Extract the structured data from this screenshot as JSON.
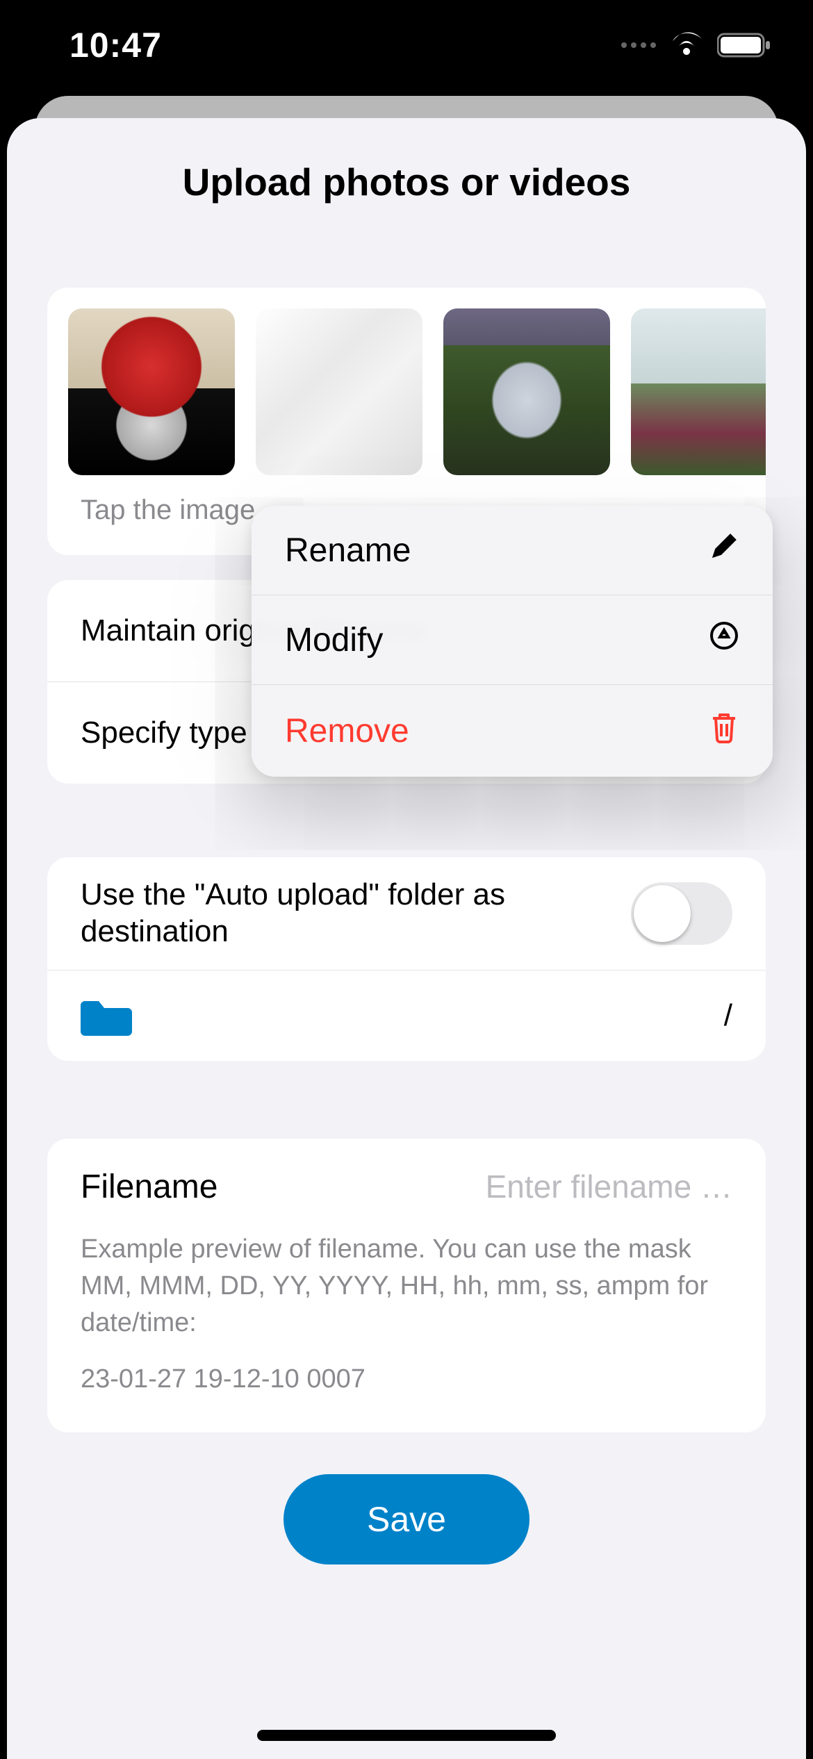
{
  "status": {
    "time": "10:47"
  },
  "sheet": {
    "title": "Upload photos or videos"
  },
  "media": {
    "hint": "Tap the image"
  },
  "options": {
    "maintain": "Maintain original filename",
    "specify": "Specify type"
  },
  "destination": {
    "auto_upload": "Use the \"Auto upload\" folder as destination",
    "path": "/"
  },
  "filename": {
    "label": "Filename",
    "placeholder": "Enter filename …",
    "hint": "Example preview of filename. You can use the mask MM, MMM, DD, YY, YYYY, HH, hh, mm, ss, ampm for date/time:",
    "example": "23-01-27 19-12-10 0007"
  },
  "save_label": "Save",
  "menu": {
    "rename": "Rename",
    "modify": "Modify",
    "remove": "Remove"
  }
}
